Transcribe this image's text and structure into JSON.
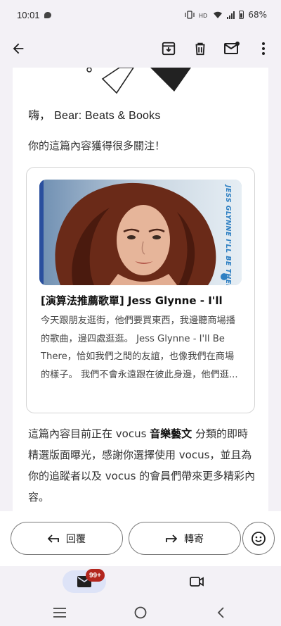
{
  "status_bar": {
    "time": "10:01",
    "battery": "68%",
    "icons": [
      "chat-bubble-icon",
      "vibrate-icon",
      "hd-icon",
      "wifi-icon",
      "signal-icon",
      "battery-icon"
    ]
  },
  "toolbar": {
    "icons": [
      "back-arrow-icon",
      "archive-icon",
      "trash-icon",
      "mark-unread-icon",
      "more-vert-icon"
    ]
  },
  "email": {
    "greeting_prefix": "嗨，",
    "greeting_name": "Bear: Beats & Books",
    "lead": "你的這篇內容獲得很多關注！",
    "card": {
      "image_side_text": "JESS GLYNNE I'LL BE THERE",
      "title": "[演算法推薦歌單] Jess Glynne - I'll",
      "excerpt": "今天跟朋友逛街，他們要買東西，我邊聽商場播的歌曲，邊四處逛逛。 Jess Glynne - I'll Be There，恰如我們之間的友誼，也像我們在商場的樣子。 我們不會永遠跟在彼此身邊，他們逛..."
    },
    "body_before": "這篇內容目前正在 vocus ",
    "body_bold": "音樂藝文",
    "body_after": " 分類的即時精選版面曝光，感謝你選擇使用 vocus，並且為你的追蹤者以及 vocus 的會員們帶來更多精彩內容。"
  },
  "reply_bar": {
    "reply_label": "回覆",
    "forward_label": "轉寄"
  },
  "bottom_nav": {
    "mail_badge": "99+"
  },
  "colors": {
    "badge": "#b3261e",
    "active_tab": "#dde3f7",
    "background": "#f3f1f6"
  }
}
